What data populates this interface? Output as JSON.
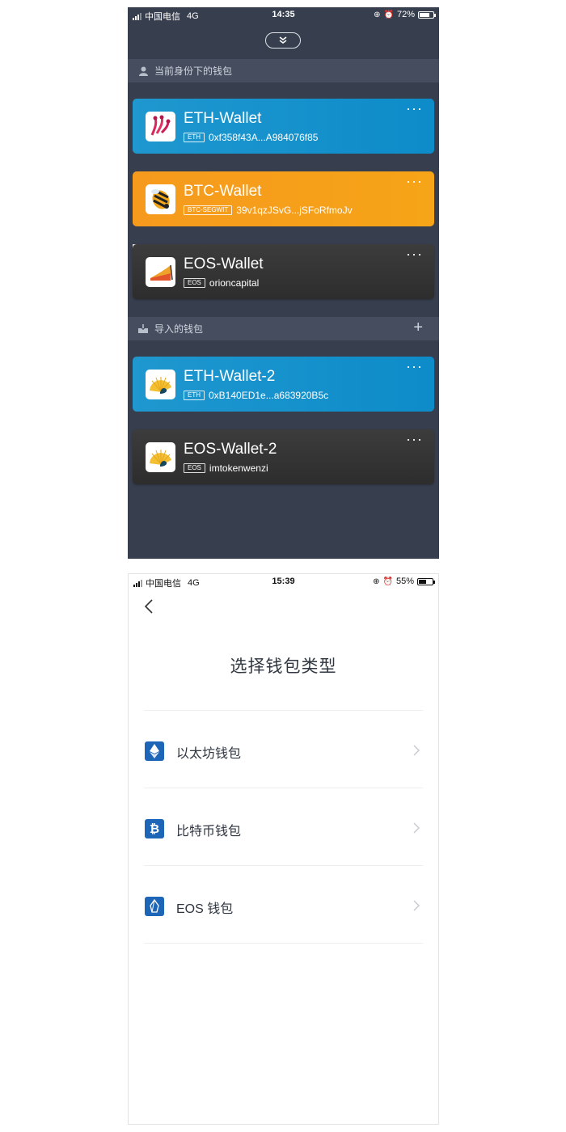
{
  "screen1": {
    "status": {
      "carrier": "中国电信",
      "network": "4G",
      "time": "14:35",
      "battery": "72%",
      "battery_level": 0.72
    },
    "section_current": "当前身份下的钱包",
    "section_imported": "导入的钱包",
    "wallets_current": [
      {
        "name": "ETH-Wallet",
        "tag": "ETH",
        "address": "0xf358f43A...A984076f85",
        "color": "blue",
        "logo": "eth-bird-logo"
      },
      {
        "name": "BTC-Wallet",
        "tag": "BTC-SEGWIT",
        "address": "39v1qzJSvG...jSFoRfmoJv",
        "color": "orange",
        "logo": "bee-logo"
      },
      {
        "name": "EOS-Wallet",
        "tag": "EOS",
        "address": "orioncapital",
        "color": "dark",
        "logo": "orion-logo"
      }
    ],
    "wallets_imported": [
      {
        "name": "ETH-Wallet-2",
        "tag": "ETH",
        "address": "0xB140ED1e...a683920B5c",
        "color": "blue",
        "logo": "shell-logo"
      },
      {
        "name": "EOS-Wallet-2",
        "tag": "EOS",
        "address": "imtokenwenzi",
        "color": "dark",
        "logo": "shell-logo"
      }
    ],
    "more_label": "···"
  },
  "screen2": {
    "status": {
      "carrier": "中国电信",
      "network": "4G",
      "time": "15:39",
      "battery": "55%",
      "battery_level": 0.55
    },
    "title": "选择钱包类型",
    "options": [
      {
        "label": "以太坊钱包",
        "icon": "ethereum-icon"
      },
      {
        "label": "比特币钱包",
        "icon": "bitcoin-icon"
      },
      {
        "label": "EOS 钱包",
        "icon": "eos-icon"
      }
    ]
  },
  "colors": {
    "dark_bg": "#373e4e",
    "section_bg": "#454d5f",
    "blue": "#1a94cd",
    "orange": "#f69f1b",
    "accent": "#1d65b7"
  }
}
